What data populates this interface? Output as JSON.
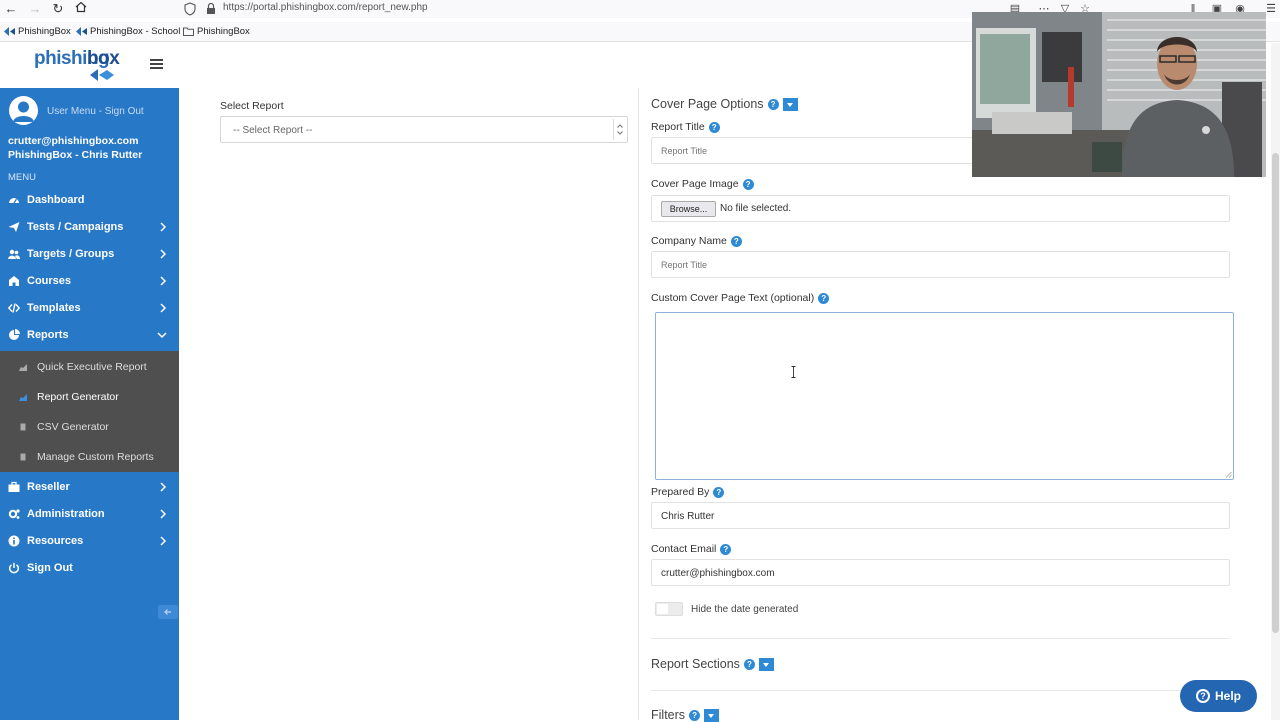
{
  "browser": {
    "url": "https://portal.phishingbox.com/report_new.php",
    "bookmarks": [
      "PhishingBox",
      "PhishingBox - School",
      "PhishingBox"
    ]
  },
  "brand": {
    "logo_top": "phishing",
    "logo_bottom": "box"
  },
  "sidebar": {
    "user_links": "User Menu - Sign Out",
    "email": "crutter@phishingbox.com",
    "org": "PhishingBox - Chris Rutter",
    "menu_label": "MENU",
    "items": [
      {
        "label": "Dashboard",
        "icon": "dashboard-icon",
        "chevron": false
      },
      {
        "label": "Tests / Campaigns",
        "icon": "paper-plane-icon",
        "chevron": true
      },
      {
        "label": "Targets / Groups",
        "icon": "users-icon",
        "chevron": true
      },
      {
        "label": "Courses",
        "icon": "graduation-cap-icon",
        "chevron": true
      },
      {
        "label": "Templates",
        "icon": "code-icon",
        "chevron": true
      },
      {
        "label": "Reports",
        "icon": "chart-pie-icon",
        "chevron": true,
        "expanded": true
      },
      {
        "label": "Reseller",
        "icon": "briefcase-icon",
        "chevron": true
      },
      {
        "label": "Administration",
        "icon": "cogs-icon",
        "chevron": true
      },
      {
        "label": "Resources",
        "icon": "info-icon",
        "chevron": true
      },
      {
        "label": "Sign Out",
        "icon": "power-icon",
        "chevron": false
      }
    ],
    "sub_items": [
      {
        "label": "Quick Executive Report",
        "active": false
      },
      {
        "label": "Report Generator",
        "active": true
      },
      {
        "label": "CSV Generator",
        "active": false
      },
      {
        "label": "Manage Custom Reports",
        "active": false
      }
    ]
  },
  "report_select": {
    "label": "Select Report",
    "value": "-- Select Report --"
  },
  "cover": {
    "section_title": "Cover Page Options",
    "report_title_label": "Report Title",
    "report_title_placeholder": "Report Title",
    "image_label": "Cover Page Image",
    "browse_label": "Browse...",
    "no_file": "No file selected.",
    "company_label": "Company Name",
    "company_placeholder": "Report Title",
    "custom_text_label": "Custom Cover Page Text (optional)",
    "prepared_by_label": "Prepared By",
    "prepared_by_value": "Chris Rutter",
    "contact_label": "Contact Email",
    "contact_value": "crutter@phishingbox.com",
    "hide_date_label": "Hide the date generated",
    "hide_date_on": false
  },
  "sections": {
    "report_sections": "Report Sections",
    "filters": "Filters"
  },
  "help": {
    "label": "Help"
  },
  "colors": {
    "sidebar": "#2878c8",
    "submenu": "#4f4f4f",
    "accent": "#2f8ad6",
    "help": "#2566b3"
  }
}
